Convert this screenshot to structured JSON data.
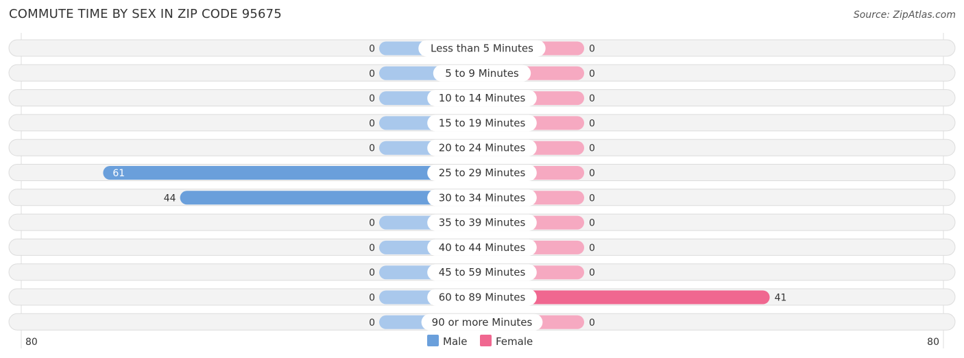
{
  "chart_data": {
    "type": "bar",
    "title": "COMMUTE TIME BY SEX IN ZIP CODE 95675",
    "source": "Source: ZipAtlas.com",
    "categories": [
      "Less than 5 Minutes",
      "5 to 9 Minutes",
      "10 to 14 Minutes",
      "15 to 19 Minutes",
      "20 to 24 Minutes",
      "25 to 29 Minutes",
      "30 to 34 Minutes",
      "35 to 39 Minutes",
      "40 to 44 Minutes",
      "45 to 59 Minutes",
      "60 to 89 Minutes",
      "90 or more Minutes"
    ],
    "series": [
      {
        "name": "Male",
        "color": "#6a9fdb",
        "values": [
          0,
          0,
          0,
          0,
          0,
          61,
          44,
          0,
          0,
          0,
          0,
          0
        ]
      },
      {
        "name": "Female",
        "color": "#f06790",
        "values": [
          0,
          0,
          0,
          0,
          0,
          0,
          0,
          0,
          0,
          0,
          41,
          0
        ]
      }
    ],
    "axis_left_label": "80",
    "axis_right_label": "80",
    "xlim": [
      -80,
      80
    ],
    "legend": "bottom-center",
    "orientation": "horizontal-diverging"
  }
}
